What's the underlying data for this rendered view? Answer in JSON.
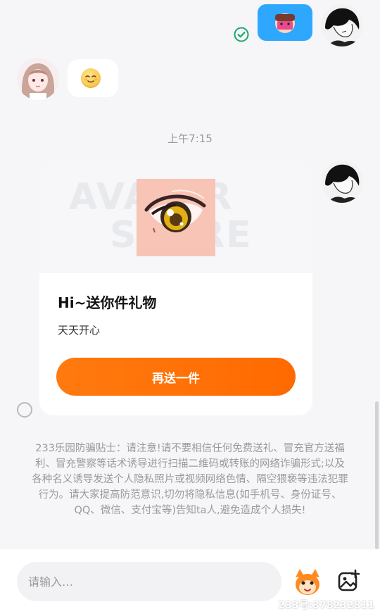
{
  "chat": {
    "time_label": "上午7:15",
    "incoming_emoji": "😌"
  },
  "gift_card": {
    "title": "Hi~送你件礼物",
    "subtitle": "天天开心",
    "button_label": "再送一件",
    "watermark": [
      "AVATAR",
      "STORE"
    ]
  },
  "notice": {
    "text": "233乐园防骗贴士：请注意!请不要相信任何免费送礼、冒充官方送福利、冒充警察等话术诱导进行扫描二维码或转账的网络诈骗形式;以及各种名义诱导发送个人隐私照片或视频网络色情、隔空猥亵等违法犯罪行为。请大家提高防范意识,切勿将隐私信息(如手机号、身份证号、QQ、微信、支付宝等)告知ta人,避免造成个人损失!"
  },
  "input": {
    "placeholder": "请输入…"
  },
  "watermark_id": "233号:378232811",
  "colors": {
    "accent_orange": "#ff6a00",
    "bubble_blue": "#2ea7ff",
    "check_green": "#1aa86a",
    "background": "#f6f6f9"
  },
  "icons": [
    "check-circle-icon",
    "emoji-face-icon",
    "radio-circle-icon",
    "mascot-icon",
    "image-add-icon"
  ]
}
